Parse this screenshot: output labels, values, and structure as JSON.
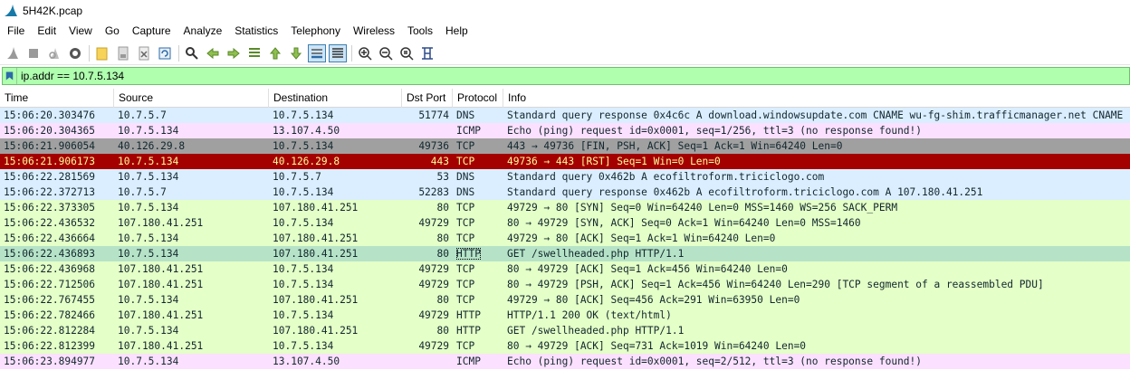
{
  "window": {
    "title": "5H42K.pcap"
  },
  "menu": [
    "File",
    "Edit",
    "View",
    "Go",
    "Capture",
    "Analyze",
    "Statistics",
    "Telephony",
    "Wireless",
    "Tools",
    "Help"
  ],
  "toolbar": {
    "buttons": [
      "start-capture-icon",
      "stop-capture-icon",
      "restart-capture-icon",
      "capture-options-icon",
      "open-file-icon",
      "save-file-icon",
      "close-file-icon",
      "reload-file-icon",
      "find-packet-icon",
      "go-back-icon",
      "go-forward-icon",
      "go-to-packet-icon",
      "go-first-icon",
      "go-last-icon",
      "autoscroll-icon",
      "colorize-icon",
      "zoom-in-icon",
      "zoom-out-icon",
      "normal-size-icon",
      "resize-columns-icon"
    ]
  },
  "filter": {
    "value": "ip.addr == 10.7.5.134"
  },
  "columns": {
    "time": "Time",
    "source": "Source",
    "destination": "Destination",
    "dst_port": "Dst Port",
    "protocol": "Protocol",
    "info": "Info"
  },
  "colors": {
    "udp": "#daeeff",
    "icmp": "#fce0ff",
    "tcp": "#e7e6ff",
    "http": "#e4ffc7",
    "tcp_fin": "#a0a0a0",
    "tcp_rst": "#a40000",
    "selected": "#b6e3c7"
  },
  "packets": [
    {
      "time": "15:06:20.303476",
      "source": "10.7.5.7",
      "destination": "10.7.5.134",
      "dst_port": "51774",
      "protocol": "DNS",
      "info": "Standard query response 0x4c6c A download.windowsupdate.com CNAME wu-fg-shim.trafficmanager.net CNAME",
      "color": "#daeeff",
      "fg": "#12272e"
    },
    {
      "time": "15:06:20.304365",
      "source": "10.7.5.134",
      "destination": "13.107.4.50",
      "dst_port": "",
      "protocol": "ICMP",
      "info": "Echo (ping) request  id=0x0001, seq=1/256, ttl=3 (no response found!)",
      "color": "#fce0ff",
      "fg": "#12272e"
    },
    {
      "time": "15:06:21.906054",
      "source": "40.126.29.8",
      "destination": "10.7.5.134",
      "dst_port": "49736",
      "protocol": "TCP",
      "info": "443 → 49736 [FIN, PSH, ACK] Seq=1 Ack=1 Win=64240 Len=0",
      "color": "#a0a0a0",
      "fg": "#12272e"
    },
    {
      "time": "15:06:21.906173",
      "source": "10.7.5.134",
      "destination": "40.126.29.8",
      "dst_port": "443",
      "protocol": "TCP",
      "info": "49736 → 443 [RST] Seq=1 Win=0 Len=0",
      "color": "#a40000",
      "fg": "#fffc9c"
    },
    {
      "time": "15:06:22.281569",
      "source": "10.7.5.134",
      "destination": "10.7.5.7",
      "dst_port": "53",
      "protocol": "DNS",
      "info": "Standard query 0x462b A ecofiltroform.triciclogo.com",
      "color": "#daeeff",
      "fg": "#12272e"
    },
    {
      "time": "15:06:22.372713",
      "source": "10.7.5.7",
      "destination": "10.7.5.134",
      "dst_port": "52283",
      "protocol": "DNS",
      "info": "Standard query response 0x462b A ecofiltroform.triciclogo.com A 107.180.41.251",
      "color": "#daeeff",
      "fg": "#12272e"
    },
    {
      "time": "15:06:22.373305",
      "source": "10.7.5.134",
      "destination": "107.180.41.251",
      "dst_port": "80",
      "protocol": "TCP",
      "info": "49729 → 80 [SYN] Seq=0 Win=64240 Len=0 MSS=1460 WS=256 SACK_PERM",
      "color": "#e4ffc7",
      "fg": "#12272e"
    },
    {
      "time": "15:06:22.436532",
      "source": "107.180.41.251",
      "destination": "10.7.5.134",
      "dst_port": "49729",
      "protocol": "TCP",
      "info": "80 → 49729 [SYN, ACK] Seq=0 Ack=1 Win=64240 Len=0 MSS=1460",
      "color": "#e4ffc7",
      "fg": "#12272e"
    },
    {
      "time": "15:06:22.436664",
      "source": "10.7.5.134",
      "destination": "107.180.41.251",
      "dst_port": "80",
      "protocol": "TCP",
      "info": "49729 → 80 [ACK] Seq=1 Ack=1 Win=64240 Len=0",
      "color": "#e4ffc7",
      "fg": "#12272e"
    },
    {
      "time": "15:06:22.436893",
      "source": "10.7.5.134",
      "destination": "107.180.41.251",
      "dst_port": "80",
      "protocol": "HTTP",
      "info": "GET /swellheaded.php HTTP/1.1",
      "color": "#b6e3c7",
      "fg": "#12272e",
      "selected": true
    },
    {
      "time": "15:06:22.436968",
      "source": "107.180.41.251",
      "destination": "10.7.5.134",
      "dst_port": "49729",
      "protocol": "TCP",
      "info": "80 → 49729 [ACK] Seq=1 Ack=456 Win=64240 Len=0",
      "color": "#e4ffc7",
      "fg": "#12272e"
    },
    {
      "time": "15:06:22.712506",
      "source": "107.180.41.251",
      "destination": "10.7.5.134",
      "dst_port": "49729",
      "protocol": "TCP",
      "info": "80 → 49729 [PSH, ACK] Seq=1 Ack=456 Win=64240 Len=290 [TCP segment of a reassembled PDU]",
      "color": "#e4ffc7",
      "fg": "#12272e"
    },
    {
      "time": "15:06:22.767455",
      "source": "10.7.5.134",
      "destination": "107.180.41.251",
      "dst_port": "80",
      "protocol": "TCP",
      "info": "49729 → 80 [ACK] Seq=456 Ack=291 Win=63950 Len=0",
      "color": "#e4ffc7",
      "fg": "#12272e"
    },
    {
      "time": "15:06:22.782466",
      "source": "107.180.41.251",
      "destination": "10.7.5.134",
      "dst_port": "49729",
      "protocol": "HTTP",
      "info": "HTTP/1.1 200 OK  (text/html)",
      "color": "#e4ffc7",
      "fg": "#12272e"
    },
    {
      "time": "15:06:22.812284",
      "source": "10.7.5.134",
      "destination": "107.180.41.251",
      "dst_port": "80",
      "protocol": "HTTP",
      "info": "GET /swellheaded.php HTTP/1.1",
      "color": "#e4ffc7",
      "fg": "#12272e"
    },
    {
      "time": "15:06:22.812399",
      "source": "107.180.41.251",
      "destination": "10.7.5.134",
      "dst_port": "49729",
      "protocol": "TCP",
      "info": "80 → 49729 [ACK] Seq=731 Ack=1019 Win=64240 Len=0",
      "color": "#e4ffc7",
      "fg": "#12272e"
    },
    {
      "time": "15:06:23.894977",
      "source": "10.7.5.134",
      "destination": "13.107.4.50",
      "dst_port": "",
      "protocol": "ICMP",
      "info": "Echo (ping) request  id=0x0001, seq=2/512, ttl=3 (no response found!)",
      "color": "#fce0ff",
      "fg": "#12272e"
    }
  ]
}
